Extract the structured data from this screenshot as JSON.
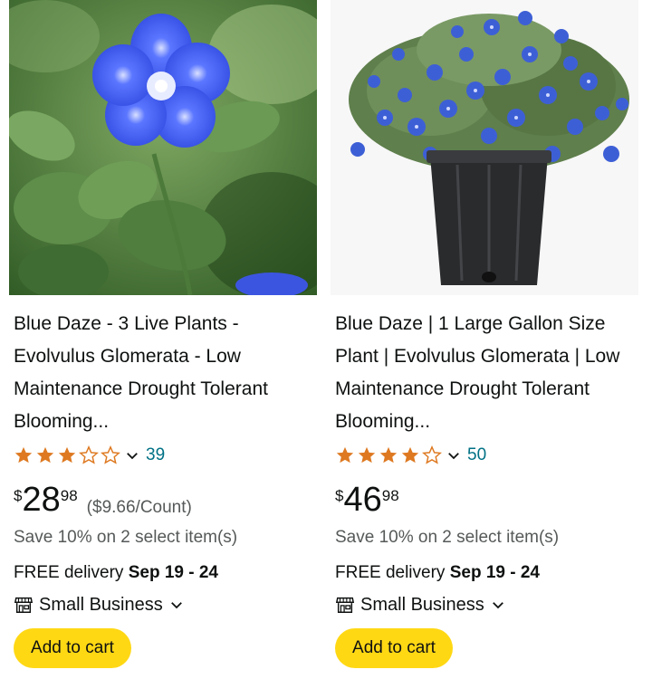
{
  "products": [
    {
      "image_alt": "blue-daze-flower-closeup",
      "title": "Blue Daze - 3 Live Plants - Evolvulus Glomerata - Low Maintenance Drought Tolerant Blooming...",
      "rating": 3.5,
      "rating_max": 5,
      "review_count": "39",
      "price_currency": "$",
      "price_whole": "28",
      "price_fraction": "98",
      "unit_price": "($9.66/Count)",
      "promo": "Save 10% on 2 select item(s)",
      "delivery_label": "FREE delivery ",
      "delivery_date": "Sep 19 - 24",
      "badge": "Small Business",
      "cart_label": "Add to cart"
    },
    {
      "image_alt": "blue-daze-potted-plant",
      "title": "Blue Daze | 1 Large Gallon Size Plant | Evolvulus Glomerata | Low Maintenance Drought Tolerant Blooming...",
      "rating": 4.5,
      "rating_max": 5,
      "review_count": "50",
      "price_currency": "$",
      "price_whole": "46",
      "price_fraction": "98",
      "unit_price": "",
      "promo": "Save 10% on 2 select item(s)",
      "delivery_label": "FREE delivery ",
      "delivery_date": "Sep 19 - 24",
      "badge": "Small Business",
      "cart_label": "Add to cart"
    }
  ],
  "colors": {
    "star": "#de7921",
    "link": "#007185",
    "cart_button": "#ffd814",
    "muted_text": "#565959"
  }
}
